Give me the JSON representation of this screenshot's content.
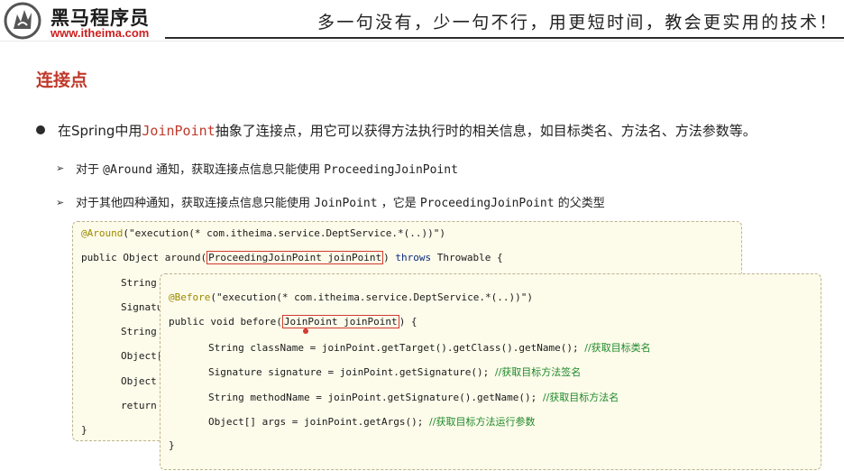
{
  "header": {
    "brand_name": "黑马程序员",
    "brand_url": "www.itheima.com",
    "slogan": "多一句没有，少一句不行，用更短时间，教会更实用的技术！"
  },
  "section_title": "连接点",
  "bullet_main": {
    "prefix": "在Spring中用",
    "keyword": "JoinPoint",
    "suffix": "抽象了连接点，用它可以获得方法执行时的相关信息，如目标类名、方法名、方法参数等。"
  },
  "sub_bullets": [
    {
      "arrow": "➢",
      "part1": "对于 ",
      "code1": "@Around",
      "part2": " 通知，获取连接点信息只能使用  ",
      "code2": "ProceedingJoinPoint",
      "part3": ""
    },
    {
      "arrow": "➢",
      "part1": "对于其他四种通知，获取连接点信息只能使用 ",
      "code1": "JoinPoint",
      "part2": " ，它是 ",
      "code2": "ProceedingJoinPoint",
      "part3": " 的父类型"
    }
  ],
  "around_code": {
    "annotation": "@Around",
    "annotation_arg": "(\"execution(* com.itheima.service.DeptService.*(..))\")",
    "sig_prefix": "public Object around(",
    "sig_param": "ProceedingJoinPoint joinPoint",
    "sig_mid": ") ",
    "sig_throws": "throws",
    "sig_suffix": " Throwable {",
    "lines": [
      "String",
      "Signatu",
      "String",
      "Object[",
      "Object",
      "return"
    ],
    "close": "}"
  },
  "before_code": {
    "annotation": "@Before",
    "annotation_arg": "(\"execution(* com.itheima.service.DeptService.*(..))\")",
    "sig_prefix": "public void before(",
    "sig_param": "JoinPoint joinPoint",
    "sig_suffix": ") {",
    "lines": [
      {
        "code": "String className = joinPoint.getTarget().getClass().getName(); ",
        "comment": "//获取目标类名"
      },
      {
        "code": "Signature signature = joinPoint.getSignature(); ",
        "comment": "//获取目标方法签名"
      },
      {
        "code": "String methodName = joinPoint.getSignature().getName(); ",
        "comment": "//获取目标方法名"
      },
      {
        "code": "Object[] args = joinPoint.getArgs(); ",
        "comment": "//获取目标方法运行参数"
      }
    ],
    "close": "}"
  },
  "colors": {
    "accent_red": "#c0392b",
    "code_bg": "#fdfbea",
    "comment_green": "#1f8a2a",
    "annotation_olive": "#9b8a00",
    "keyword_blue": "#0a2a80"
  }
}
